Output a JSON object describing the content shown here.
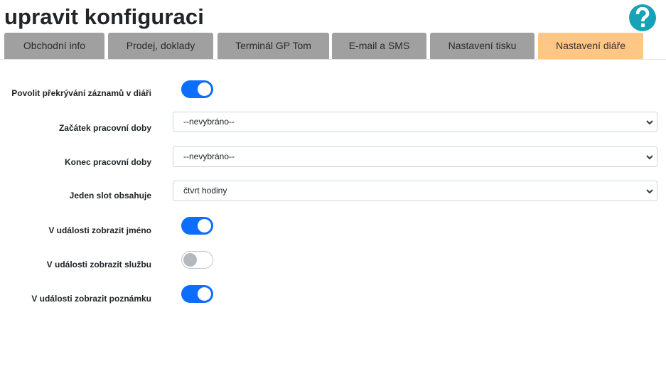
{
  "page": {
    "title": "upravit konfiguraci"
  },
  "help": {
    "icon": "question-circle-icon",
    "color": "#17a2b8"
  },
  "tabs": [
    {
      "label": "Obchodní info",
      "active": false
    },
    {
      "label": "Prodej, doklady",
      "active": false
    },
    {
      "label": "Terminál GP Tom",
      "active": false
    },
    {
      "label": "E-mail a SMS",
      "active": false
    },
    {
      "label": "Nastavení tisku",
      "active": false
    },
    {
      "label": "Nastavení diáře",
      "active": true
    }
  ],
  "colors": {
    "tab_inactive": "#a0a0a0",
    "tab_active": "#ffc685",
    "toggle_on": "#0d6efd"
  },
  "form": {
    "allow_overlap": {
      "label": "Povolit překrývání záznamů v diáři",
      "checked": true
    },
    "work_start": {
      "label": "Začátek pracovní doby",
      "value": "--nevybráno--"
    },
    "work_end": {
      "label": "Konec pracovní doby",
      "value": "--nevybráno--"
    },
    "slot": {
      "label": "Jeden slot obsahuje",
      "value": "čtvrt hodiny"
    },
    "show_name": {
      "label": "V události zobrazit jméno",
      "checked": true
    },
    "show_service": {
      "label": "V události zobrazit službu",
      "checked": false
    },
    "show_note": {
      "label": "V události zobrazit poznámku",
      "checked": true
    }
  }
}
